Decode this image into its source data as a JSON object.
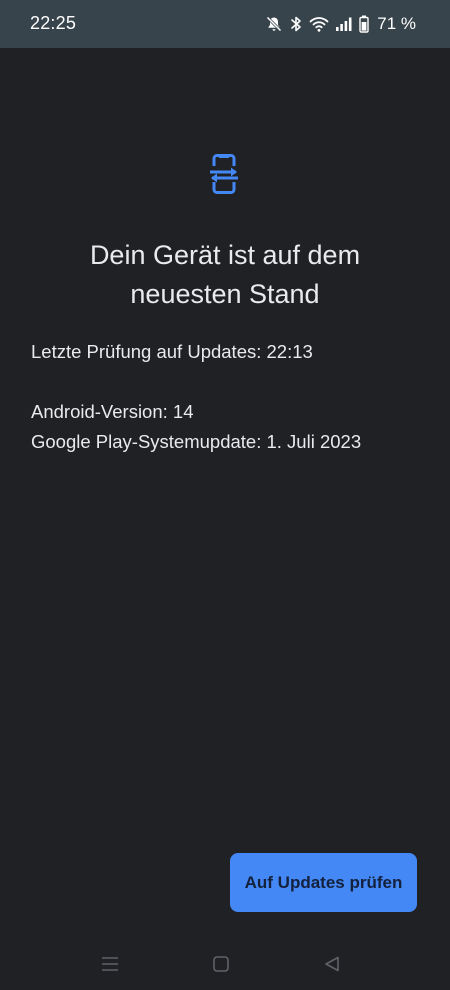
{
  "status_bar": {
    "time": "22:25",
    "battery": "71 %",
    "icons": [
      "mute-icon",
      "bluetooth-icon",
      "wifi-icon",
      "signal-icon",
      "battery-icon"
    ]
  },
  "main": {
    "icon": "system-update-icon",
    "title": "Dein Gerät ist auf dem neuesten Stand",
    "last_check": "Letzte Prüfung auf Updates: 22:13",
    "android_version": "Android-Version: 14",
    "play_system_update": "Google Play-Systemupdate: 1. Juli 2023",
    "check_button_label": "Auf Updates prüfen"
  },
  "nav_bar": {
    "buttons": [
      "menu-icon",
      "home-icon",
      "back-icon"
    ]
  },
  "colors": {
    "background": "#202124",
    "status_bar": "#37444b",
    "accent": "#4488f5",
    "text": "#e8eaed"
  }
}
